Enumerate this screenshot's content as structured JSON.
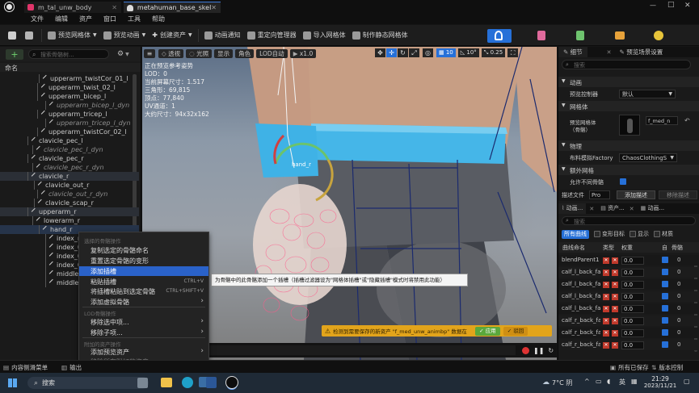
{
  "window": {
    "tabs": [
      {
        "label": "m_tal_unw_body"
      },
      {
        "label": "metahuman_base_skel"
      }
    ],
    "controls": {
      "minimize": "—",
      "maximize": "□",
      "close": "✕"
    }
  },
  "menu": [
    "文件",
    "编辑",
    "资产",
    "窗口",
    "工具",
    "帮助"
  ],
  "toolbar": {
    "preview_mesh": "预览网格体",
    "preview_anim": "预览动画",
    "create_asset": "创建资产",
    "anim_notify": "动画通知",
    "retarget_manager": "重定向管理器",
    "import_mesh": "导入网格体",
    "make_static_mesh": "制作静态网格体"
  },
  "left_panel": {
    "search_placeholder": "搜索骨骼树...",
    "header": "命名",
    "rows": [
      {
        "label": "upperarm_twistCor_01_l"
      },
      {
        "label": "upperarm_twist_02_l"
      },
      {
        "label": "upperarm_bicep_l"
      },
      {
        "label": "upperarm_bicep_l_dyn"
      },
      {
        "label": "upperarm_tricep_l"
      },
      {
        "label": "upperarm_tricep_l_dyn"
      },
      {
        "label": "upperarm_twistCor_02_l"
      },
      {
        "label": "clavicle_pec_l"
      },
      {
        "label": "clavicle_pec_l_dyn"
      },
      {
        "label": "clavicle_pec_r"
      },
      {
        "label": "clavicle_pec_r_dyn"
      },
      {
        "label": "clavicle_r"
      },
      {
        "label": "clavicle_out_r"
      },
      {
        "label": "clavicle_out_r_dyn"
      },
      {
        "label": "clavicle_scap_r"
      },
      {
        "label": "upperarm_r"
      },
      {
        "label": "lowerarm_r"
      },
      {
        "label": "hand_r"
      },
      {
        "label": "index_metacarpal_r"
      },
      {
        "label": "index_01_r"
      },
      {
        "label": "index_02_r"
      },
      {
        "label": "index_03_r"
      },
      {
        "label": "middle_metacarpal_r"
      },
      {
        "label": "middle_01_r"
      }
    ]
  },
  "viewport": {
    "perspective": "透视",
    "lit": "光照",
    "show": "显示",
    "character": "角色",
    "lod": "LOD自动",
    "speed": "x1.0",
    "snap_grid": "10",
    "snap_angle": "10°",
    "snap_scale": "0.25",
    "info": [
      "正在预览参考姿势",
      "LOD：0",
      "当前屏幕尺寸：1.517",
      "三角形：69,815",
      "顶点：77,840",
      "UV通道：1",
      "大约尺寸：94x32x162"
    ],
    "bone_label": "hand_r",
    "tooltip": "为骨骼中的此骨骼添加一个插槽（插槽过滤器设为\"网格体插槽\"或\"隐藏插槽\"模式时将禁用此功能）",
    "warning": "检测到需要保存的新资产 \"f_med_unw_animbp\" 数据在",
    "warning_apply": "应用",
    "warning_dismiss": "驳回"
  },
  "context_menu": {
    "sections": [
      {
        "title": "选择的骨骼操作"
      },
      {
        "title": "LOD骨骼操作"
      },
      {
        "title": "附加的资产操作"
      }
    ],
    "items": [
      {
        "label": "复制选定的骨骼命名"
      },
      {
        "label": "重置选定骨骼的变形"
      },
      {
        "label": "添加插槽"
      },
      {
        "label": "粘贴插槽",
        "shortcut": "CTRL+V"
      },
      {
        "label": "将插槽粘贴到选定骨骼",
        "shortcut": "CTRL+SHIFT+V"
      },
      {
        "label": "添加虚拟骨骼"
      },
      {
        "label": "移除选中项..."
      },
      {
        "label": "移除子项..."
      },
      {
        "label": "添加预览资产"
      },
      {
        "label": "移除所有附加的资产"
      }
    ]
  },
  "details_panel": {
    "tab_details": "细节",
    "tab_preview": "预览场景设置",
    "search_placeholder": "搜索",
    "section_anim": "动画",
    "preview_controller_label": "预览控制器",
    "preview_controller_value": "默认",
    "section_mesh": "网格体",
    "preview_mesh_label": "预览网格体\n（骨骼）",
    "preview_mesh_value": "f_med_n",
    "section_physics": "物理",
    "cloth_factory_label": "布料模拟Factory",
    "cloth_factory_value": "ChaosClothingS",
    "section_extra": "额外网格",
    "allow_diff_label": "允许不同骨骼",
    "desc_file_label": "描述文件",
    "desc_file_value": "Pro",
    "add_desc_button": "添加描述",
    "remove_desc_button": "移除描述"
  },
  "curves_panel": {
    "tab_anim": "动画...",
    "tab_asset": "资产...",
    "tab_anim2": "动画...",
    "search_placeholder": "搜索",
    "filters": {
      "all": "所有曲线",
      "morph": "变形目标",
      "show": "显示",
      "material": "材质"
    },
    "header": {
      "name": "曲线命名",
      "type": "类型",
      "weight": "权重",
      "auto": "自",
      "bone": "骨骼"
    },
    "rows": [
      {
        "name": "blendParent1",
        "weight": "0.0",
        "bone": "0"
      },
      {
        "name": "calf_l_back_fa",
        "weight": "0.0",
        "bone": "0"
      },
      {
        "name": "calf_l_back_fa",
        "weight": "0.0",
        "bone": "0"
      },
      {
        "name": "calf_l_back_fa",
        "weight": "0.0",
        "bone": "0"
      },
      {
        "name": "calf_l_back_fa",
        "weight": "0.0",
        "bone": "0"
      },
      {
        "name": "calf_r_back_fa",
        "weight": "0.0",
        "bone": "0"
      },
      {
        "name": "calf_r_back_fa",
        "weight": "0.0",
        "bone": "0"
      },
      {
        "name": "calf_r_back_fa",
        "weight": "0.0",
        "bone": "0"
      }
    ]
  },
  "bottom": {
    "drawer": "内容侧滑菜单",
    "output": "输出",
    "saved": "所有已保存",
    "version": "版本控制"
  },
  "taskbar": {
    "search": "搜索",
    "weather": "7°C 阴",
    "lang": "英",
    "time": "21:29",
    "date": "2023/11/21"
  }
}
